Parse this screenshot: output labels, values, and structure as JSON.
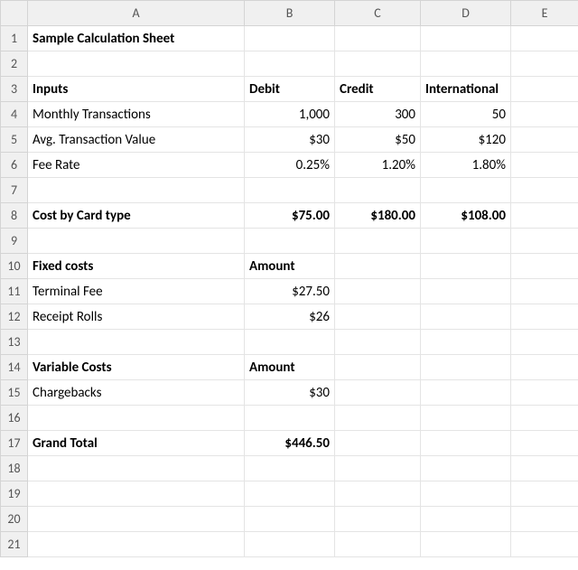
{
  "columns": [
    "",
    "A",
    "B",
    "C",
    "D",
    "E"
  ],
  "rows": {
    "r1": {
      "A": "Sample Calculation Sheet"
    },
    "r2": {},
    "r3": {
      "A": "Inputs",
      "B": "Debit",
      "C": "Credit",
      "D": "International"
    },
    "r4": {
      "A": "Monthly Transactions",
      "B": "1,000",
      "C": "300",
      "D": "50"
    },
    "r5": {
      "A": "Avg. Transaction Value",
      "B": "$30",
      "C": "$50",
      "D": "$120"
    },
    "r6": {
      "A": "Fee Rate",
      "B": "0.25%",
      "C": "1.20%",
      "D": "1.80%"
    },
    "r7": {},
    "r8": {
      "A": "Cost by Card type",
      "B": "$75.00",
      "C": "$180.00",
      "D": "$108.00"
    },
    "r9": {},
    "r10": {
      "A": "Fixed costs",
      "B": "Amount"
    },
    "r11": {
      "A": "Terminal Fee",
      "B": "$27.50"
    },
    "r12": {
      "A": "Receipt Rolls",
      "B": "$26"
    },
    "r13": {},
    "r14": {
      "A": "Variable Costs",
      "B": "Amount"
    },
    "r15": {
      "A": "Chargebacks",
      "B": "$30"
    },
    "r16": {},
    "r17": {
      "A": "Grand Total",
      "B": "$446.50"
    },
    "r18": {},
    "r19": {},
    "r20": {},
    "r21": {}
  },
  "chart_data": {
    "type": "table",
    "title": "Sample Calculation Sheet",
    "sections": [
      {
        "name": "Inputs",
        "columns": [
          "Debit",
          "Credit",
          "International"
        ],
        "rows": [
          {
            "label": "Monthly Transactions",
            "values": [
              1000,
              300,
              50
            ]
          },
          {
            "label": "Avg. Transaction Value",
            "values": [
              30,
              50,
              120
            ],
            "unit": "$"
          },
          {
            "label": "Fee Rate",
            "values": [
              0.0025,
              0.012,
              0.018
            ],
            "unit": "%"
          }
        ]
      },
      {
        "name": "Cost by Card type",
        "columns": [
          "Debit",
          "Credit",
          "International"
        ],
        "rows": [
          {
            "label": "Cost by Card type",
            "values": [
              75.0,
              180.0,
              108.0
            ],
            "unit": "$"
          }
        ]
      },
      {
        "name": "Fixed costs",
        "columns": [
          "Amount"
        ],
        "rows": [
          {
            "label": "Terminal Fee",
            "values": [
              27.5
            ],
            "unit": "$"
          },
          {
            "label": "Receipt Rolls",
            "values": [
              26
            ],
            "unit": "$"
          }
        ]
      },
      {
        "name": "Variable Costs",
        "columns": [
          "Amount"
        ],
        "rows": [
          {
            "label": "Chargebacks",
            "values": [
              30
            ],
            "unit": "$"
          }
        ]
      },
      {
        "name": "Grand Total",
        "columns": [
          "Amount"
        ],
        "rows": [
          {
            "label": "Grand Total",
            "values": [
              446.5
            ],
            "unit": "$"
          }
        ]
      }
    ]
  }
}
